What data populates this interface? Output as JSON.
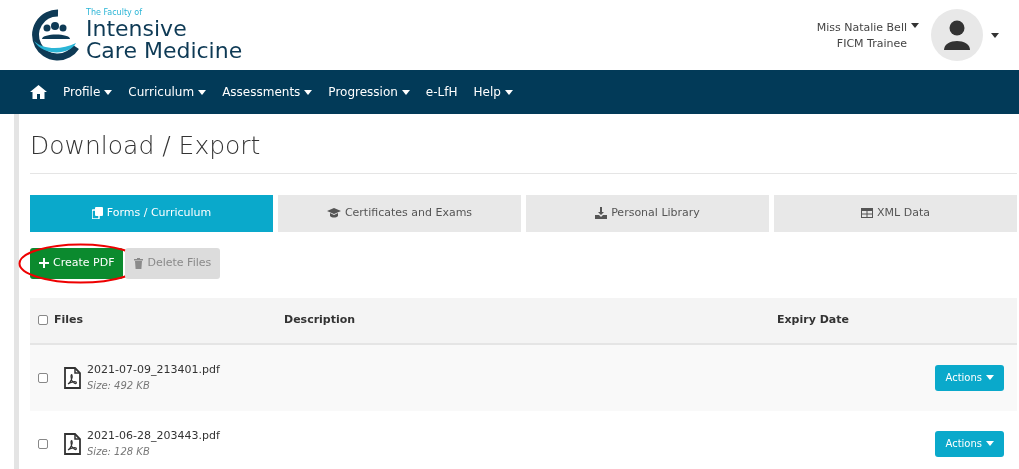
{
  "logo": {
    "lines": [
      "The Faculty of",
      "Intensive",
      "Care Medicine"
    ]
  },
  "user": {
    "name": "Miss Natalie Bell",
    "role": "FICM Trainee"
  },
  "nav": [
    {
      "label": "Profile",
      "dropdown": true
    },
    {
      "label": "Curriculum",
      "dropdown": true
    },
    {
      "label": "Assessments",
      "dropdown": true
    },
    {
      "label": "Progression",
      "dropdown": true
    },
    {
      "label": "e-LfH",
      "dropdown": false
    },
    {
      "label": "Help",
      "dropdown": true
    }
  ],
  "page_title": "Download / Export",
  "tabs": [
    {
      "label": "Forms / Curriculum",
      "kind": "copy",
      "selected": true
    },
    {
      "label": "Certificates and Exams",
      "kind": "cap",
      "selected": false
    },
    {
      "label": "Personal Library",
      "kind": "download",
      "selected": false
    },
    {
      "label": "XML Data",
      "kind": "table",
      "selected": false
    }
  ],
  "buttons": [
    {
      "label": "Create PDF",
      "kind": "create",
      "disabled": false,
      "highlighted": true
    },
    {
      "label": "Delete Files",
      "kind": "delete",
      "disabled": true,
      "highlighted": false
    }
  ],
  "table": {
    "select_all": {
      "checked": false
    },
    "columns": [
      "Files",
      "Description",
      "Expiry Date"
    ],
    "rows": [
      {
        "checked": false,
        "file": "2021-07-09_213401.pdf",
        "size": "Size: 492 KB",
        "action": "Actions"
      },
      {
        "checked": false,
        "file": "2021-06-28_203443.pdf",
        "size": "Size: 128 KB",
        "action": "Actions"
      }
    ]
  }
}
